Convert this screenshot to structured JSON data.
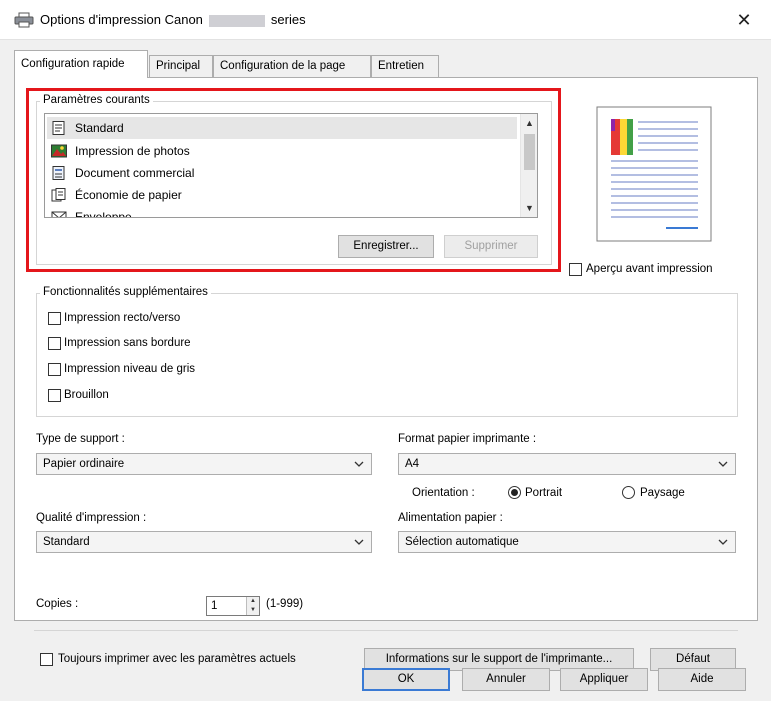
{
  "window": {
    "title_prefix": "Options d'impression Canon",
    "title_suffix": "series",
    "close_glyph": "✕"
  },
  "tabs": [
    {
      "label": "Configuration rapide",
      "active": true
    },
    {
      "label": "Principal",
      "active": false
    },
    {
      "label": "Configuration de la page",
      "active": false
    },
    {
      "label": "Entretien",
      "active": false
    }
  ],
  "current_settings": {
    "legend": "Paramètres courants",
    "items": [
      {
        "label": "Standard",
        "icon": "standard-doc-icon",
        "selected": true
      },
      {
        "label": "Impression de photos",
        "icon": "photo-icon",
        "selected": false
      },
      {
        "label": "Document commercial",
        "icon": "business-doc-icon",
        "selected": false
      },
      {
        "label": "Économie de papier",
        "icon": "paper-saving-icon",
        "selected": false
      },
      {
        "label": "Enveloppe",
        "icon": "envelope-icon",
        "selected": false
      }
    ],
    "save_button": "Enregistrer...",
    "delete_button": "Supprimer"
  },
  "preview": {
    "checkbox_label": "Aperçu avant impression",
    "checked": false
  },
  "additional_features": {
    "legend": "Fonctionnalités supplémentaires",
    "options": [
      {
        "label": "Impression recto/verso",
        "checked": false
      },
      {
        "label": "Impression sans bordure",
        "checked": false
      },
      {
        "label": "Impression niveau de gris",
        "checked": false
      },
      {
        "label": "Brouillon",
        "checked": false
      }
    ]
  },
  "media_type": {
    "label": "Type de support :",
    "value": "Papier ordinaire"
  },
  "paper_size": {
    "label": "Format papier imprimante :",
    "value": "A4"
  },
  "orientation": {
    "label": "Orientation :",
    "portrait": "Portrait",
    "landscape": "Paysage",
    "selected": "Portrait"
  },
  "print_quality": {
    "label": "Qualité d'impression :",
    "value": "Standard"
  },
  "paper_source": {
    "label": "Alimentation papier :",
    "value": "Sélection automatique"
  },
  "copies": {
    "label": "Copies :",
    "value": "1",
    "range": "(1-999)"
  },
  "always_print": {
    "label": "Toujours imprimer avec les paramètres actuels",
    "checked": false
  },
  "media_info_button": "Informations sur le support de l'imprimante...",
  "default_button": "Défaut",
  "footer": {
    "ok": "OK",
    "cancel": "Annuler",
    "apply": "Appliquer",
    "help": "Aide"
  },
  "colors": {
    "highlight": "#e4161b",
    "focus_border": "#3a7ad4"
  }
}
